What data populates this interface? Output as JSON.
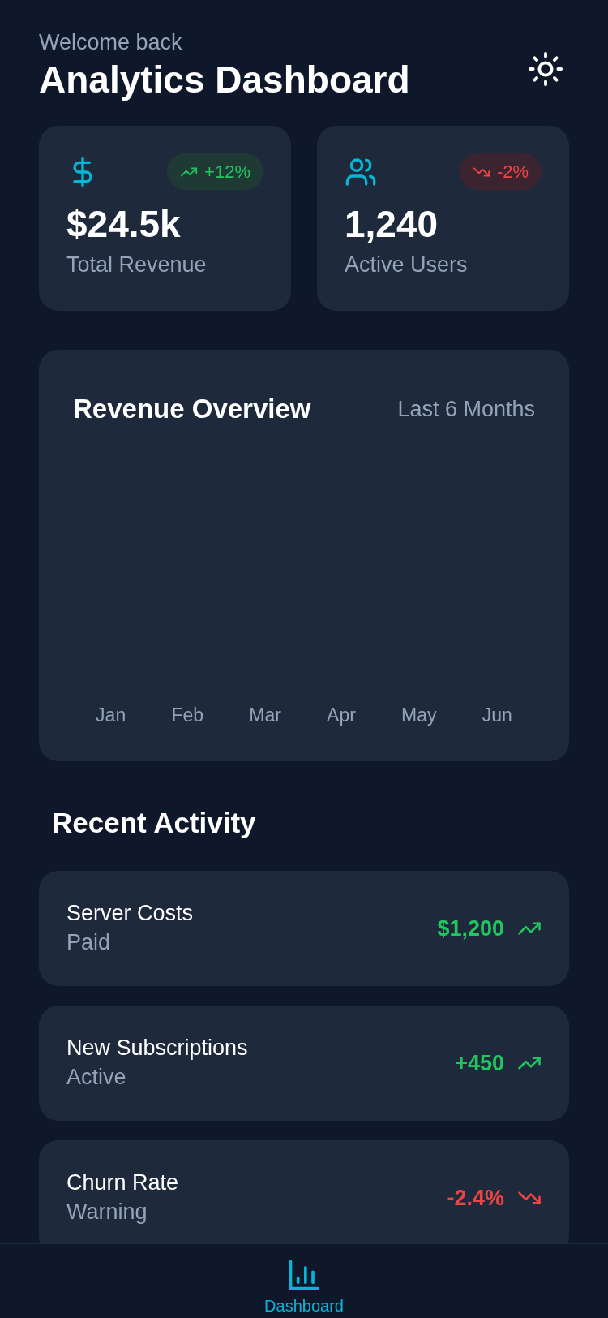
{
  "header": {
    "greeting": "Welcome back",
    "title": "Analytics Dashboard"
  },
  "stats": [
    {
      "kind": "up",
      "change": "+12%",
      "value": "$24.5k",
      "label": "Total Revenue"
    },
    {
      "kind": "down",
      "change": "-2%",
      "value": "1,240",
      "label": "Active Users"
    }
  ],
  "revenue_overview": {
    "title": "Revenue Overview",
    "period": "Last 6 Months",
    "months": [
      "Jan",
      "Feb",
      "Mar",
      "Apr",
      "May",
      "Jun"
    ]
  },
  "recent_activity": {
    "title": "Recent Activity",
    "items": [
      {
        "name": "Server Costs",
        "status": "Paid",
        "amount": "$1,200",
        "kind": "up"
      },
      {
        "name": "New Subscriptions",
        "status": "Active",
        "amount": "+450",
        "kind": "up"
      },
      {
        "name": "Churn Rate",
        "status": "Warning",
        "amount": "-2.4%",
        "kind": "down"
      }
    ]
  },
  "tab_bar": [
    {
      "label": "Dashboard",
      "selected": true
    }
  ]
}
